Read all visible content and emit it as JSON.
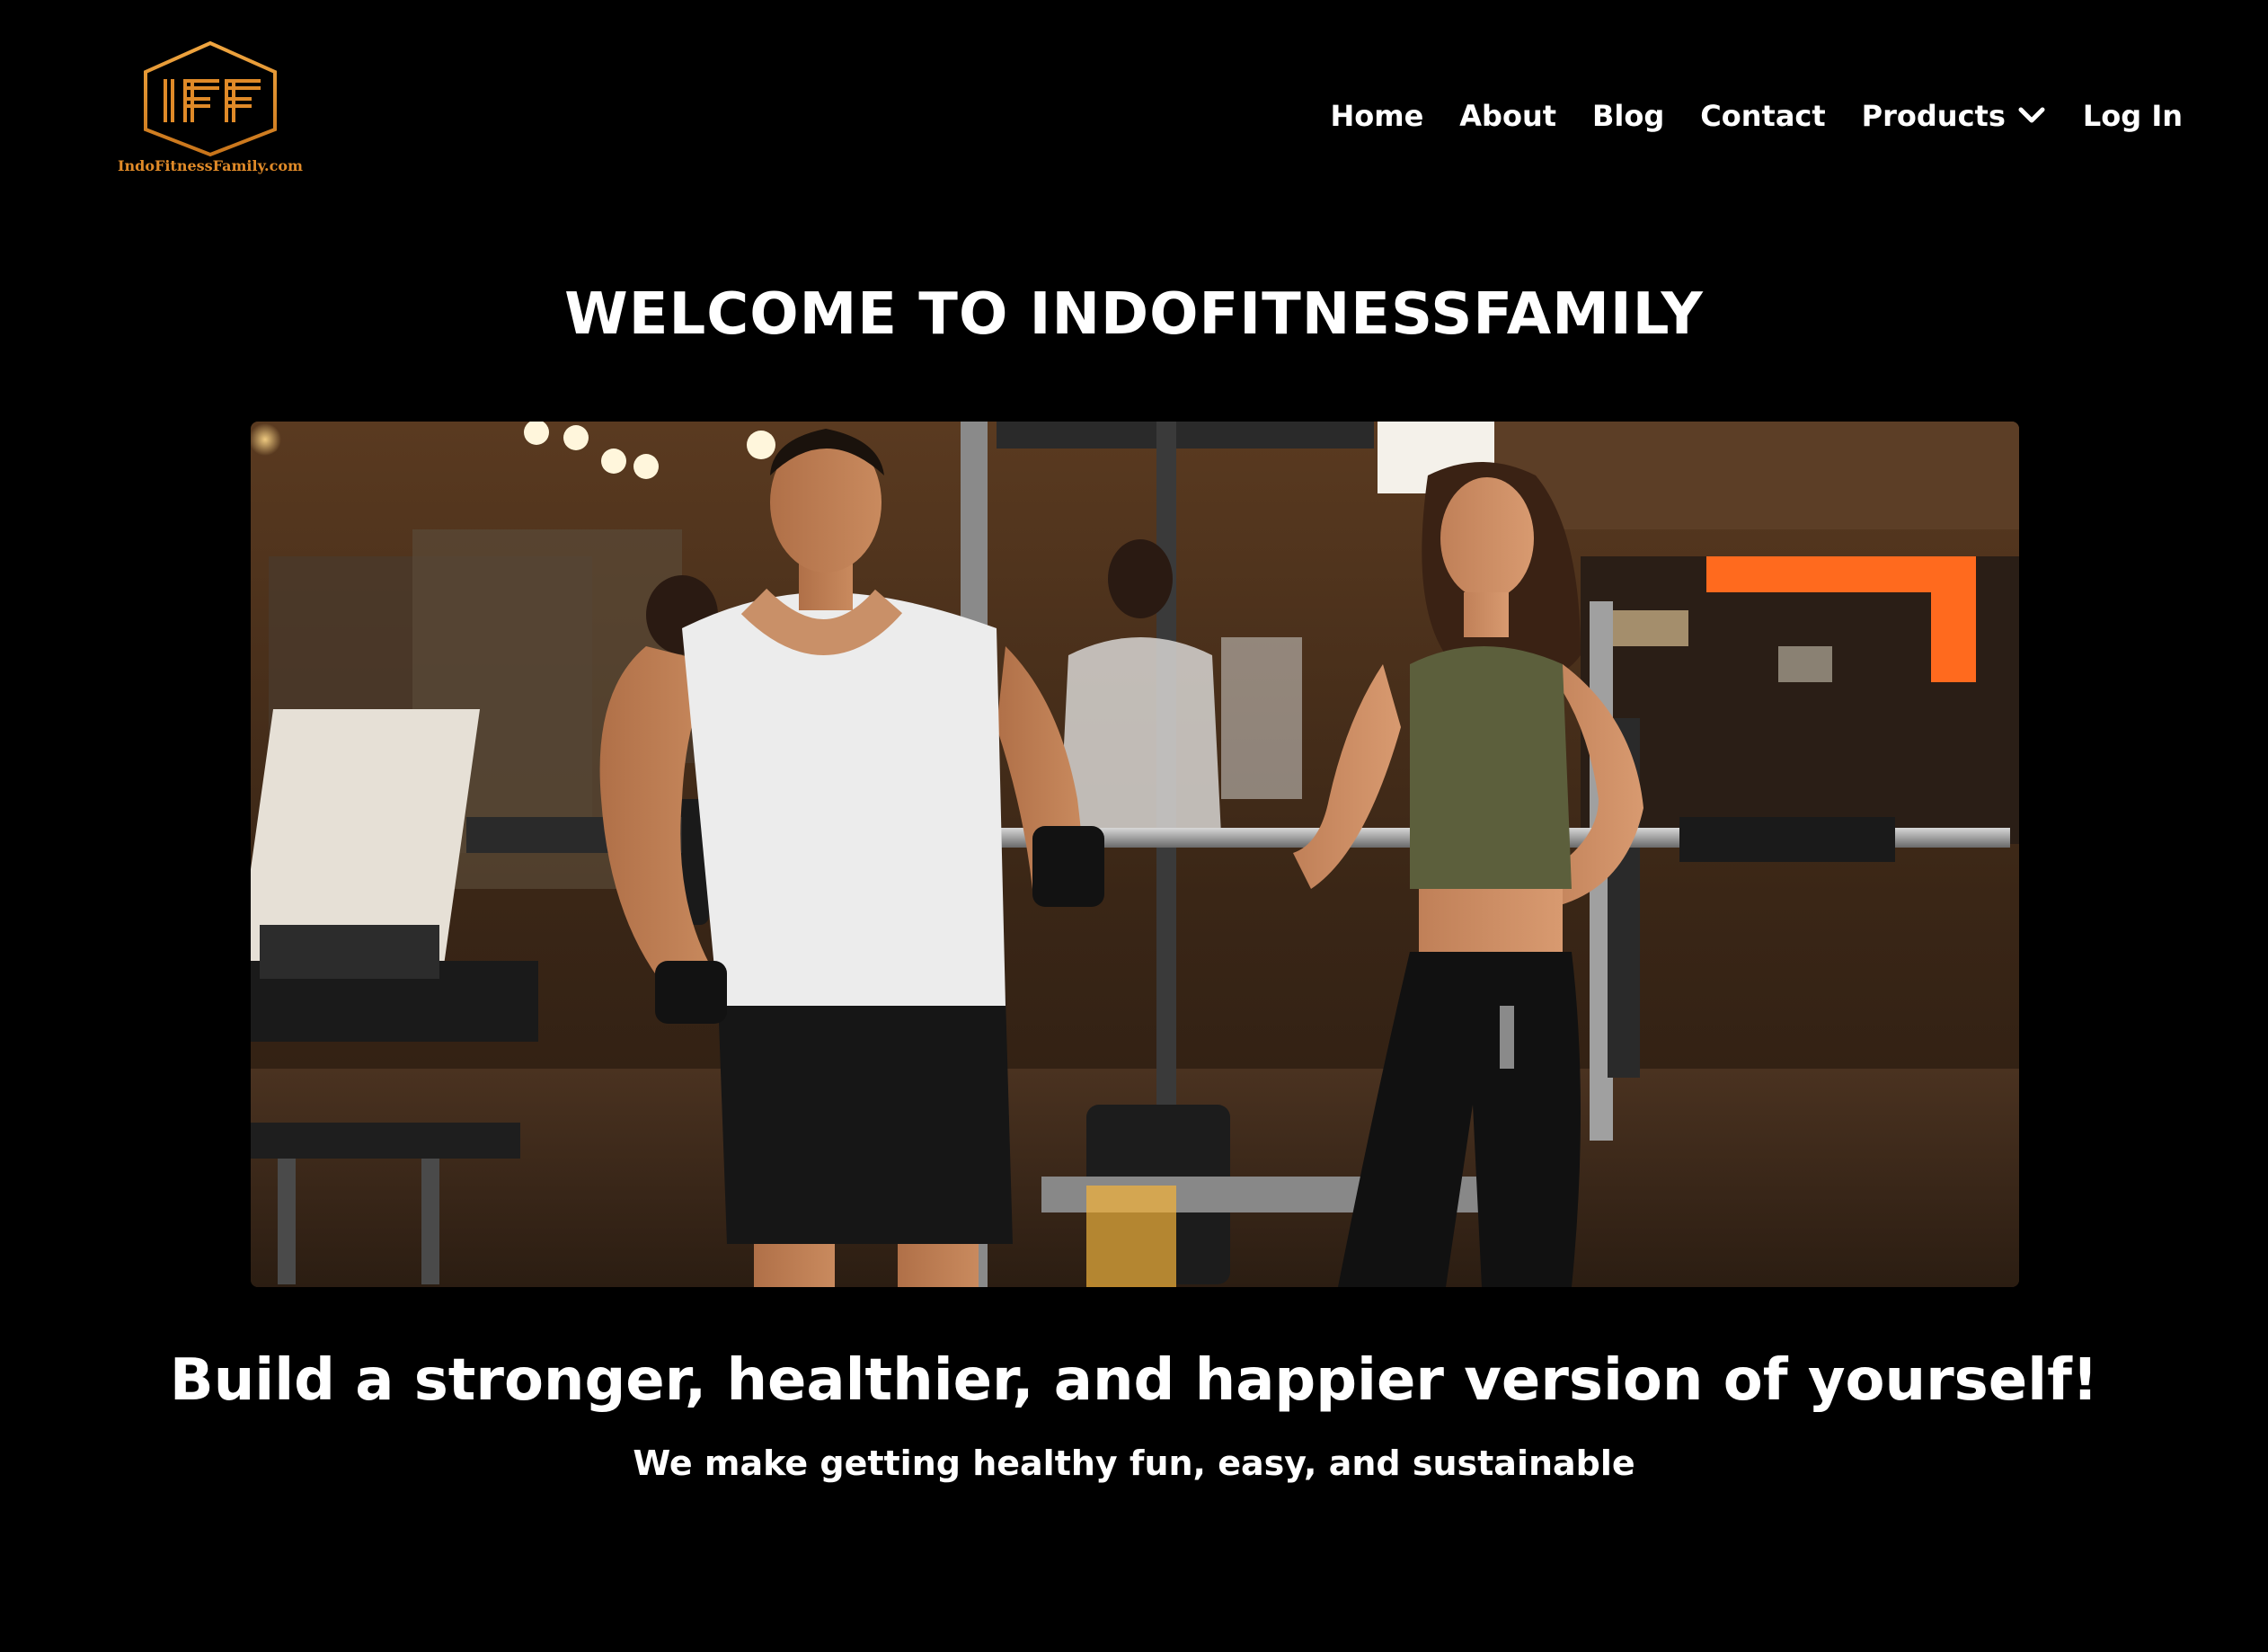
{
  "brand": {
    "logo_monogram": "IFF",
    "logo_caption": "IndoFitnessFamily.com",
    "accent_color": "#e08a28"
  },
  "nav": {
    "items": [
      {
        "label": "Home"
      },
      {
        "label": "About"
      },
      {
        "label": "Blog"
      },
      {
        "label": "Contact"
      },
      {
        "label": "Products",
        "icon": "chevron-down-icon"
      },
      {
        "label": "Log In"
      }
    ]
  },
  "hero": {
    "title": "WELCOME TO INDOFITNESSFAMILY",
    "image_alt": "",
    "tagline": "Build a stronger, healthier, and happier version of yourself!",
    "subtagline": "We make getting healthy fun, easy, and sustainable"
  },
  "colors": {
    "background": "#000000",
    "text": "#ffffff"
  }
}
